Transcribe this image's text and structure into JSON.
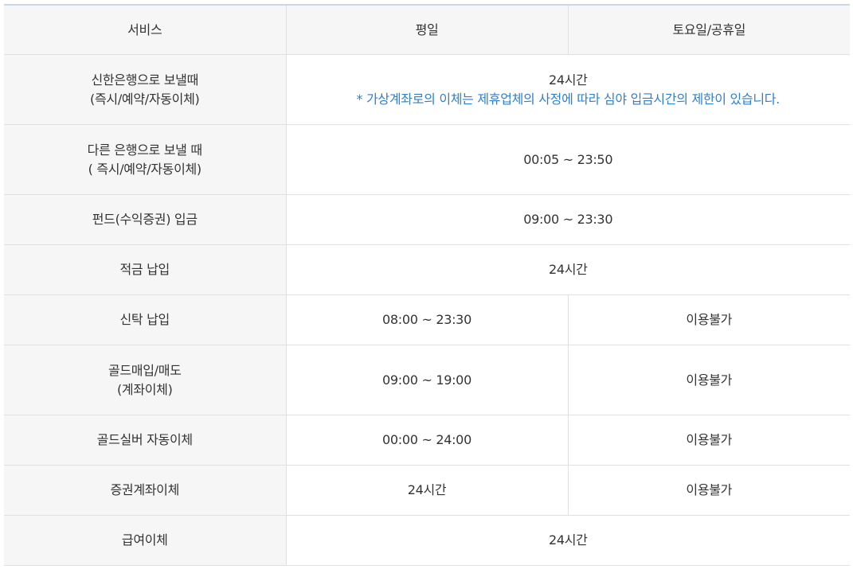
{
  "header": {
    "service": "서비스",
    "weekday": "평일",
    "weekend": "토요일/공휴일"
  },
  "rows": [
    {
      "service": [
        "신한은행으로 보낼때",
        "(즉시/예약/자동이체)"
      ],
      "all": "24시간",
      "note": "* 가상계좌로의 이체는 제휴업체의 사정에 따라 심야 입금시간의 제한이 있습니다."
    },
    {
      "service": [
        "다른 은행으로 보낼 때",
        "( 즉시/예약/자동이체)"
      ],
      "all": "00:05 ~ 23:50"
    },
    {
      "service": [
        "펀드(수익증권) 입금"
      ],
      "all": "09:00 ~ 23:30"
    },
    {
      "service": [
        "적금 납입"
      ],
      "all": "24시간"
    },
    {
      "service": [
        "신탁 납입"
      ],
      "weekday": "08:00 ~ 23:30",
      "weekend": "이용불가"
    },
    {
      "service": [
        "골드매입/매도",
        "(계좌이체)"
      ],
      "weekday": "09:00 ~ 19:00",
      "weekend": "이용불가"
    },
    {
      "service": [
        "골드실버 자동이체"
      ],
      "weekday": "00:00 ~ 24:00",
      "weekend": "이용불가"
    },
    {
      "service": [
        "증권계좌이체"
      ],
      "weekday": "24시간",
      "weekend": "이용불가"
    },
    {
      "service": [
        "급여이체"
      ],
      "all": "24시간"
    }
  ]
}
